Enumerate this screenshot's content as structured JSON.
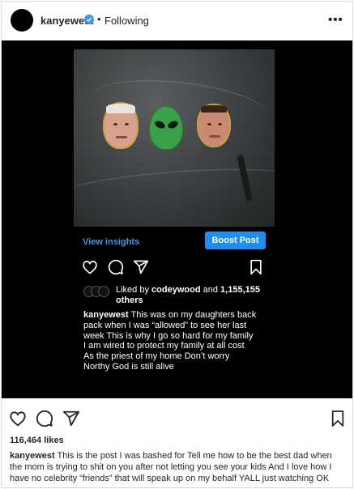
{
  "header": {
    "username": "kanyewest",
    "separator": "•",
    "following_label": "Following",
    "more_icon": "more-horizontal-icon",
    "more_label": "•••"
  },
  "media": {
    "view_insights": "View insights",
    "boost_post": "Boost Post",
    "liked_prefix": "Liked by",
    "liked_by_user": "codeywood",
    "liked_and": "and",
    "liked_count": "1,155,155",
    "liked_others": "others",
    "caption_user": "kanyewest",
    "caption_text": "This was on my daughters back\npack when I was “allowed” to see her last\nweek  This is why I go so hard for my family\nI am wired to protect my family at all cost\nAs the priest of my home  Don’t worry\nNorthy  God is still alive"
  },
  "post": {
    "likes": "116,464 likes",
    "caption_user": "kanyewest",
    "caption_text": "This is the post I was bashed for Tell me how to be the best dad when the mom is trying to shit on you after not letting you see your kids And I love how I have no celebrity “friends” that will speak up on my behalf YALL just watching OK"
  },
  "icons": {
    "like": "heart-icon",
    "comment": "comment-icon",
    "share": "paper-plane-icon",
    "save": "bookmark-icon",
    "verified": "verified-badge-icon"
  },
  "colors": {
    "accent_blue": "#3897f0",
    "boost_blue": "#1d8ff2",
    "text": "#262626",
    "media_bg": "#000000"
  }
}
